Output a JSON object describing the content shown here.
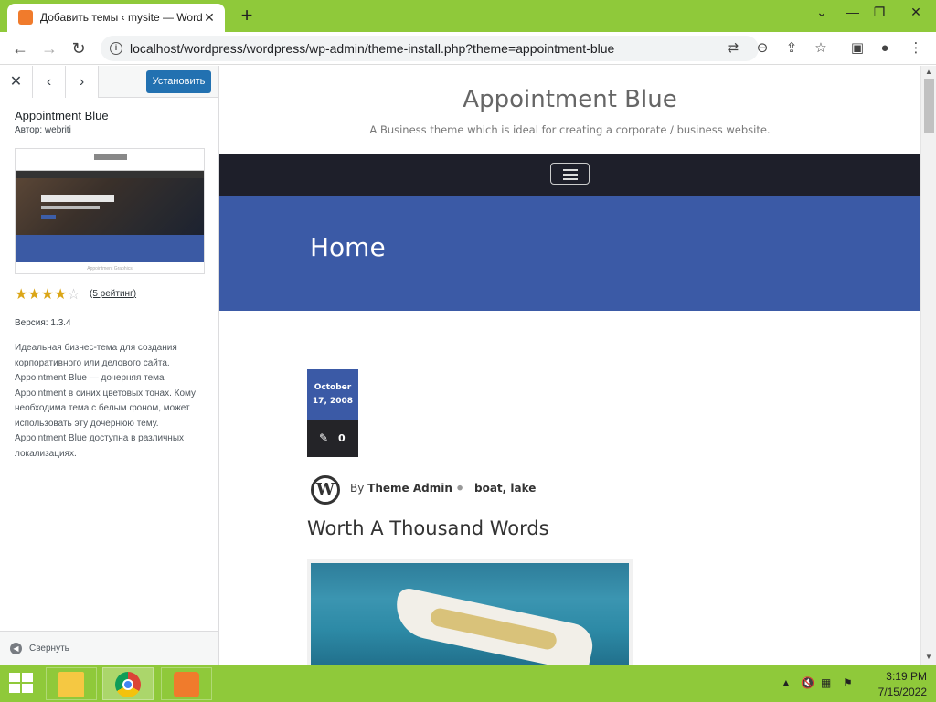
{
  "browser": {
    "tab_title": "Добавить темы ‹ mysite — WordPress",
    "tab_close": "✕",
    "new_tab": "+",
    "url": "localhost/wordpress/wordpress/wp-admin/theme-install.php?theme=appointment-blue",
    "window": {
      "minimize": "—",
      "restore": "❐",
      "close": "✕",
      "menu": "⌄"
    }
  },
  "sidebar": {
    "close_label": "✕",
    "prev_label": "‹",
    "next_label": "›",
    "install_button": "Установить",
    "theme_name": "Appointment Blue",
    "author": "Автор: webriti",
    "screenshot_caption": "Appointment Graphics",
    "rating": {
      "value": 4,
      "max": 5,
      "count_label": "(5 рейтинг)"
    },
    "version": "Версия: 1.3.4",
    "description": "Идеальная бизнес-тема для создания корпоративного или делового сайта. Appointment Blue — дочерняя тема Appointment в синих цветовых тонах. Кому необходима тема с белым фоном, может использовать эту дочернюю тему. Appointment Blue доступна в различных локализациях.",
    "collapse_label": "Свернуть"
  },
  "preview": {
    "site_title": "Appointment Blue",
    "site_description": "A Business theme which is ideal for creating a corporate / business website.",
    "page_heading": "Home",
    "post": {
      "date_line1": "October",
      "date_line2": "17, 2008",
      "comment_count": "0",
      "by_label": "By",
      "author": "Theme Admin",
      "tags": "boat,  lake",
      "title": "Worth A Thousand Words"
    }
  },
  "taskbar": {
    "clock_time": "3:19 PM",
    "clock_date": "7/15/2022"
  },
  "colors": {
    "browser_frame": "#8fc93a",
    "install_button": "#2271b1",
    "site_nav": "#1e1f2a",
    "banner": "#3b5aa6",
    "star": "#dba617"
  }
}
